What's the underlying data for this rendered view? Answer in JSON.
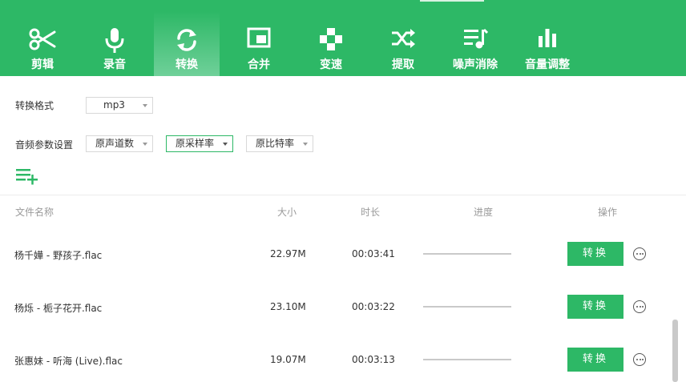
{
  "toolbar": {
    "items": [
      {
        "label": "剪辑",
        "icon": "scissors-icon"
      },
      {
        "label": "录音",
        "icon": "microphone-icon"
      },
      {
        "label": "转换",
        "icon": "convert-icon",
        "active": true
      },
      {
        "label": "合并",
        "icon": "merge-icon"
      },
      {
        "label": "变速",
        "icon": "speed-icon"
      },
      {
        "label": "提取",
        "icon": "extract-icon"
      },
      {
        "label": "噪声消除",
        "icon": "noise-removal-icon"
      },
      {
        "label": "音量调整",
        "icon": "volume-icon"
      }
    ],
    "accent": "#2db866"
  },
  "settings": {
    "format_label": "转换格式",
    "format_value": "mp3",
    "params_label": "音频参数设置",
    "channels_value": "原声道数",
    "sample_rate_value": "原采样率",
    "bitrate_value": "原比特率"
  },
  "table": {
    "headers": {
      "name": "文件名称",
      "size": "大小",
      "duration": "时长",
      "progress": "进度",
      "action": "操作"
    },
    "rows": [
      {
        "name": "杨千嬅 - 野孩子.flac",
        "size": "22.97M",
        "duration": "00:03:41",
        "button": "转换"
      },
      {
        "name": "杨烁 - 栀子花开.flac",
        "size": "23.10M",
        "duration": "00:03:22",
        "button": "转换"
      },
      {
        "name": "张惠妹 - 听海 (Live).flac",
        "size": "19.07M",
        "duration": "00:03:13",
        "button": "转换"
      }
    ]
  }
}
